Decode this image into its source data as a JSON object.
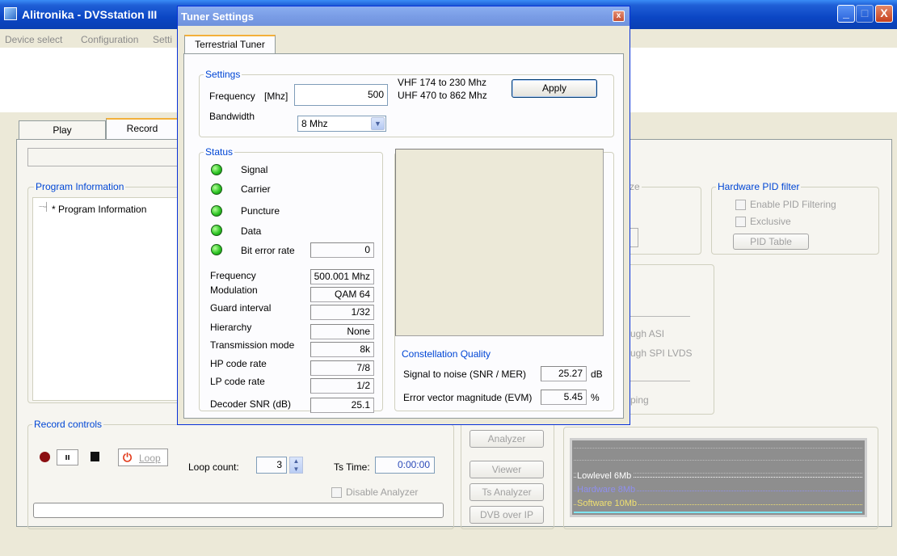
{
  "app": {
    "title": "Alitronika - DVSstation III",
    "menu": [
      "Device select",
      "Configuration",
      "Setti"
    ],
    "window_controls": {
      "minimize": "_",
      "maximize": "□",
      "close": "X"
    }
  },
  "main": {
    "tabs": [
      "Play",
      "Record"
    ],
    "program_info": {
      "group": "Program Information",
      "tree_item": "Program Information"
    },
    "capture_group_fragment": "ze",
    "hw_pid": {
      "group": "Hardware PID filter",
      "enable": "Enable PID Filtering",
      "exclusive": "Exclusive",
      "table_button": "PID Table"
    },
    "routing": {
      "asi": "ugh ASI",
      "spi": "ugh SPI LVDS",
      "looping": "ping"
    },
    "record_controls": {
      "group": "Record controls",
      "loop_label": "Loop",
      "loop_count_label": "Loop count:",
      "loop_count_value": "3",
      "ts_time_label": "Ts Time:",
      "ts_time_value": "0:00:00",
      "disable_analyzer": "Disable Analyzer"
    },
    "side_buttons": {
      "top_partial": "Analyzer",
      "viewer": "Viewer",
      "ts_analyzer": "Ts Analyzer",
      "dvb_over_ip": "DVB over IP"
    },
    "monitor": {
      "lowlevel": "Lowlevel 6Mb",
      "hardware": "Hardware 8Mb",
      "software": "Software 10Mb"
    }
  },
  "dialog": {
    "title": "Tuner Settings",
    "close": "x",
    "tab": "Terrestrial Tuner",
    "settings": {
      "group": "Settings",
      "frequency_label": "Frequency",
      "frequency_unit": "[Mhz]",
      "frequency_value": "500",
      "vhf_range": "VHF 174 to 230 Mhz",
      "uhf_range": "UHF 470 to 862 Mhz",
      "apply_button": "Apply",
      "bandwidth_label": "Bandwidth",
      "bandwidth_value": "8 Mhz"
    },
    "status": {
      "group": "Status",
      "indicators": {
        "signal": "Signal",
        "carrier": "Carrier",
        "puncture": "Puncture",
        "data": "Data",
        "ber": "Bit error rate"
      },
      "ber_value": "0",
      "frequency": {
        "label": "Frequency",
        "value": "500.001 Mhz"
      },
      "modulation": {
        "label": "Modulation",
        "value": "QAM 64"
      },
      "guard": {
        "label": "Guard interval",
        "value": "1/32"
      },
      "hierarchy": {
        "label": "Hierarchy",
        "value": "None"
      },
      "tx_mode": {
        "label": "Transmission mode",
        "value": "8k"
      },
      "hp_rate": {
        "label": "HP code rate",
        "value": "7/8"
      },
      "lp_rate": {
        "label": "LP code rate",
        "value": "1/2"
      },
      "decoder_snr": {
        "label": "Decoder SNR (dB)",
        "value": "25.1"
      }
    },
    "constellation": {
      "group": "Constellation Quality",
      "snr_label": "Signal to noise (SNR / MER)",
      "snr_value": "25.27",
      "snr_unit": "dB",
      "evm_label": "Error vector magnitude (EVM)",
      "evm_value": "5.45",
      "evm_unit": "%"
    }
  }
}
